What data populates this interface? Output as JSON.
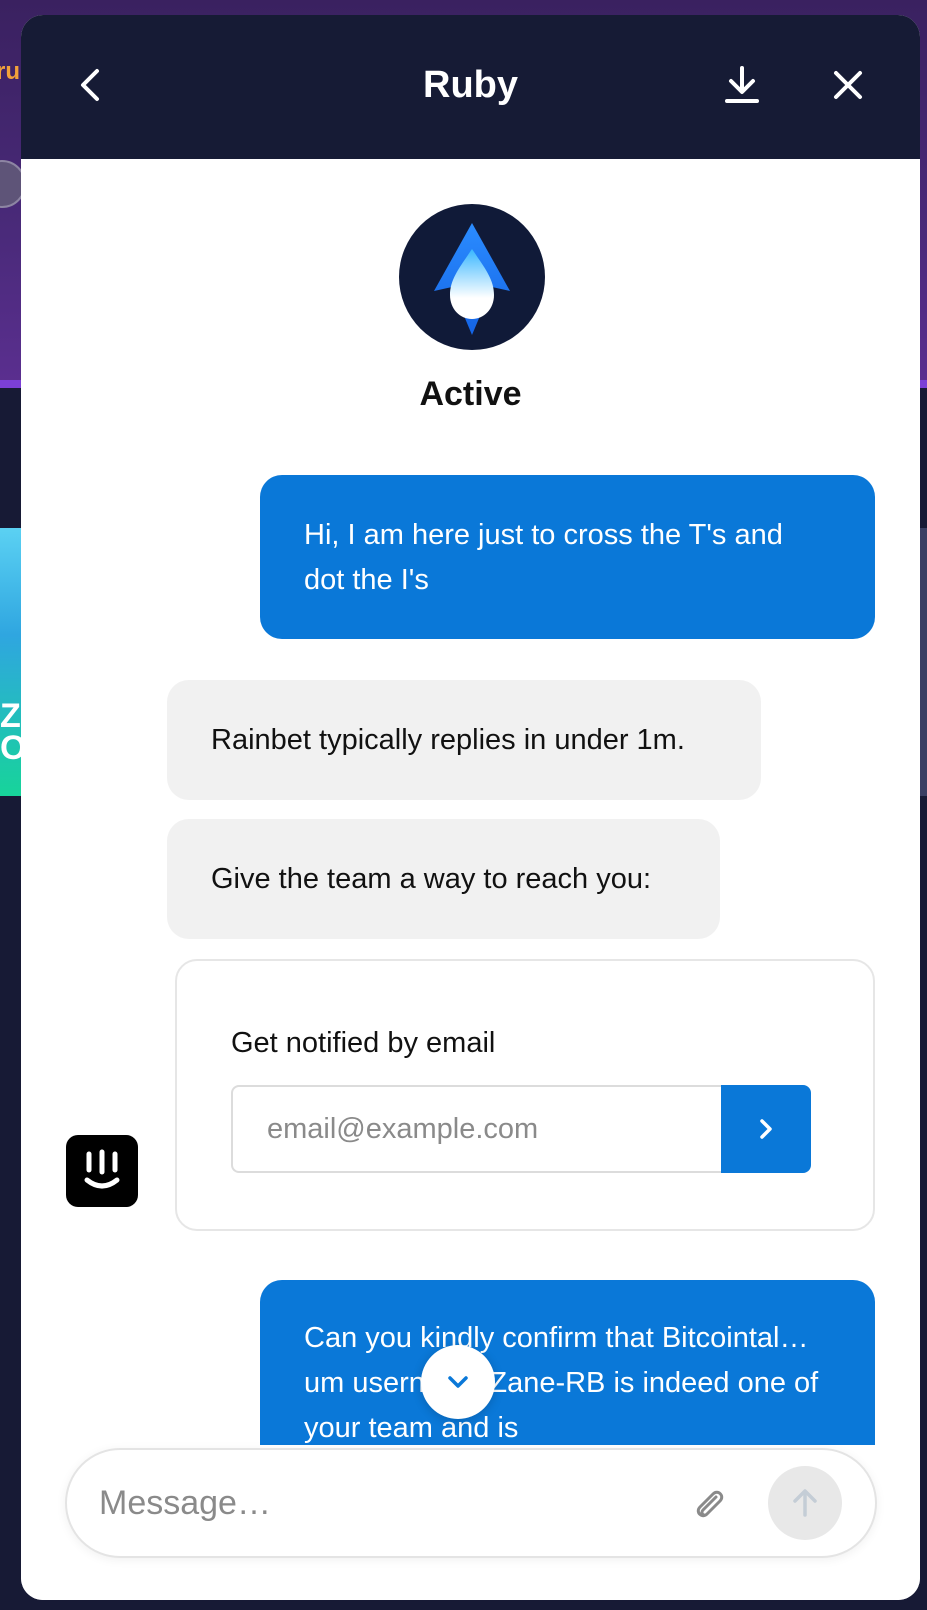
{
  "background": {
    "top_text": "ru",
    "card_text": "ZA\nON"
  },
  "header": {
    "title": "Ruby",
    "back_icon": "chevron-left-icon",
    "download_icon": "download-icon",
    "close_icon": "close-icon",
    "bg_color": "#161b35"
  },
  "agent": {
    "avatar_icon": "blue-drop-logo-icon",
    "status": "Active"
  },
  "messages": [
    {
      "from": "user",
      "text": "Hi, I am here just to cross the T's and dot the I's"
    },
    {
      "from": "bot",
      "text": "Rainbet typically replies in under 1m."
    },
    {
      "from": "bot",
      "text": "Give the team a way to reach you:"
    },
    {
      "from": "user",
      "text": "Can you kindly confirm that Bitcointal…um username Zane-RB is indeed one of your team and is"
    }
  ],
  "email_card": {
    "label": "Get notified by email",
    "placeholder": "email@example.com",
    "value": "",
    "submit_icon": "chevron-right-icon"
  },
  "bot_avatar_icon": "intercom-logo-icon",
  "scroll_down_icon": "chevron-down-icon",
  "composer": {
    "placeholder": "Message…",
    "attach_icon": "paperclip-icon",
    "send_icon": "arrow-up-icon"
  },
  "colors": {
    "accent": "#0a78d8",
    "bot_bubble": "#f1f1f1",
    "header": "#161b35"
  }
}
